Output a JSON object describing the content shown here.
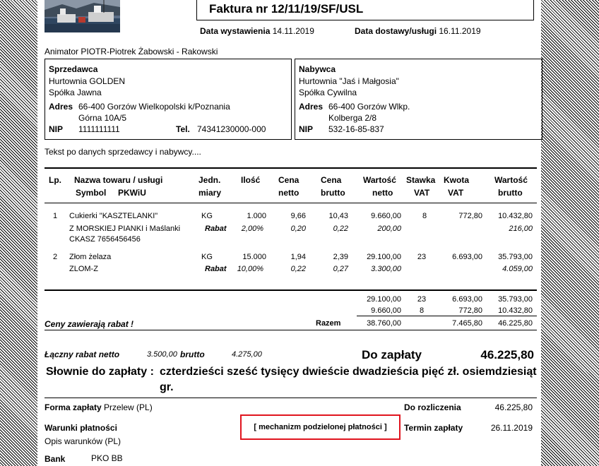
{
  "invoice": {
    "title": "Faktura nr 12/11/19/SF/USL",
    "issue_label": "Data wystawienia",
    "issue_date": "14.11.2019",
    "delivery_label": "Data dostawy/usługi",
    "delivery_date": "16.11.2019",
    "animator": "Animator PIOTR-Piotrek Żabowski - Rakowski"
  },
  "seller": {
    "heading": "Sprzedawca",
    "name1": "Hurtownia GOLDEN",
    "name2": "Spółka Jawna",
    "address_label": "Adres",
    "address1": "66-400  Gorzów Wielkopolski k/Poznania",
    "address2": "Górna 10A/5",
    "nip_label": "NIP",
    "nip": "1111111111",
    "tel_label": "Tel.",
    "tel": "74341230000-000"
  },
  "buyer": {
    "heading": "Nabywca",
    "name1": "Hurtownia \"Jaś i Małgosia\"",
    "name2": "Spółka Cywilna",
    "address_label": "Adres",
    "address1": "66-400  Gorzów Wlkp.",
    "address2": "Kolberga 2/8",
    "nip_label": "NIP",
    "nip": "532-16-85-837"
  },
  "note": "Tekst po danych sprzedawcy i nabywcy....",
  "table": {
    "headers": {
      "lp": "Lp.",
      "name1": "Nazwa towaru / usługi",
      "symbol": "Symbol",
      "pkwiu": "PKWiU",
      "unit1": "Jedn.",
      "unit2": "miary",
      "qty": "Ilość",
      "net_price1": "Cena",
      "net_price2": "netto",
      "gross_price1": "Cena",
      "gross_price2": "brutto",
      "net_value1": "Wartość",
      "net_value2": "netto",
      "vat_rate1": "Stawka",
      "vat_rate2": "VAT",
      "vat_amount1": "Kwota",
      "vat_amount2": "VAT",
      "gross_value1": "Wartość",
      "gross_value2": "brutto"
    },
    "rows": [
      {
        "lp": "1",
        "name": "Cukierki \"KASZTELANKI\"",
        "name_cont": "Z MORSKIEJ PIANKI i Maślanki",
        "symbol": "CKASZ  7656456456",
        "unit": "KG",
        "qty": "1.000",
        "net_price": "9,66",
        "gross_price": "10,43",
        "net_value": "9.660,00",
        "vat_rate": "8",
        "vat_amount": "772,80",
        "gross_value": "10.432,80",
        "rabat_label": "Rabat",
        "rabat_pct": "2,00%",
        "rabat_net_price": "0,20",
        "rabat_gross_price": "0,22",
        "rabat_net_value": "200,00",
        "rabat_gross_value": "216,00"
      },
      {
        "lp": "2",
        "name": "Złom żelaza",
        "name_cont": "",
        "symbol": "ZLOM-Z",
        "unit": "KG",
        "qty": "15.000",
        "net_price": "1,94",
        "gross_price": "2,39",
        "net_value": "29.100,00",
        "vat_rate": "23",
        "vat_amount": "6.693,00",
        "gross_value": "35.793,00",
        "rabat_label": "Rabat",
        "rabat_pct": "10,00%",
        "rabat_net_price": "0,22",
        "rabat_gross_price": "0,27",
        "rabat_net_value": "3.300,00",
        "rabat_gross_value": "4.059,00"
      }
    ]
  },
  "summary": {
    "rows": [
      {
        "net": "29.100,00",
        "rate": "23",
        "vat": "6.693,00",
        "gross": "35.793,00"
      },
      {
        "net": "9.660,00",
        "rate": "8",
        "vat": "772,80",
        "gross": "10.432,80"
      }
    ],
    "discount_note": "Ceny zawierają rabat !",
    "total_label": "Razem",
    "total_net": "38.760,00",
    "total_vat": "7.465,80",
    "total_gross": "46.225,80"
  },
  "payment": {
    "total_discount_label": "Łączny rabat netto",
    "total_discount_net": "3.500,00",
    "brutto_label": "brutto",
    "total_discount_gross": "4.275,00",
    "to_pay_label": "Do zapłaty",
    "to_pay": "46.225,80",
    "words_label": "Słownie do zapłaty :",
    "words_line1": "czterdzieści sześć tysięcy dwieście dwadzieścia pięć zł. osiemdziesiąt",
    "words_line2": "gr.",
    "form_label": "Forma zapłaty",
    "form_value": "Przelew (PL)",
    "settle_label": "Do rozliczenia",
    "settle_value": "46.225,80",
    "terms_label": "Warunki płatności",
    "split_payment": "[ mechanizm podzielonej płatności ]",
    "due_label": "Termin zapłaty",
    "due_date": "26.11.2019",
    "terms_desc": "Opis warunków (PL)",
    "bank_label": "Bank",
    "bank_value": "PKO BB"
  },
  "colors": {
    "highlight_border": "#e0141e"
  }
}
